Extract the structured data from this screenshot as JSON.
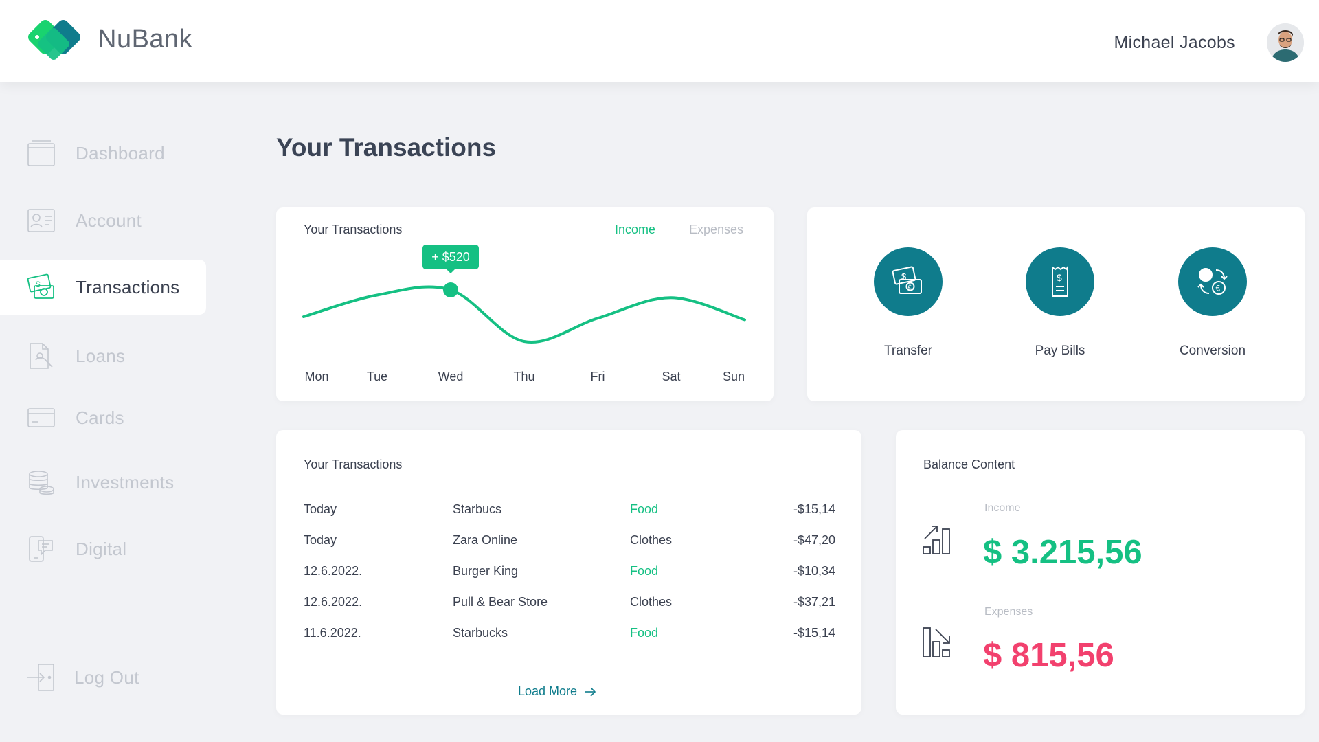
{
  "header": {
    "brand": "NuBank",
    "user_name": "Michael Jacobs"
  },
  "sidebar": {
    "items": [
      {
        "label": "Dashboard",
        "icon": "dashboard-icon",
        "active": false
      },
      {
        "label": "Account",
        "icon": "account-card-icon",
        "active": false
      },
      {
        "label": "Transactions",
        "icon": "money-bills-icon",
        "active": true
      },
      {
        "label": "Loans",
        "icon": "loan-document-icon",
        "active": false
      },
      {
        "label": "Cards",
        "icon": "credit-card-icon",
        "active": false
      },
      {
        "label": "Investments",
        "icon": "coins-stack-icon",
        "active": false
      },
      {
        "label": "Digital",
        "icon": "phone-chat-icon",
        "active": false
      }
    ],
    "logout_label": "Log Out"
  },
  "page": {
    "title": "Your Transactions"
  },
  "chart_card": {
    "title": "Your Transactions",
    "tab_income": "Income",
    "tab_expenses": "Expenses",
    "active_tab": "Income",
    "tooltip": "+ $520",
    "accent": "#15c083"
  },
  "chart_data": {
    "type": "line",
    "categories": [
      "Mon",
      "Tue",
      "Wed",
      "Thu",
      "Fri",
      "Sat",
      "Sun"
    ],
    "highlight": {
      "category": "Wed",
      "label": "+ $520"
    },
    "relative_values": [
      0.48,
      0.9,
      1.0,
      0.0,
      0.45,
      0.85,
      0.42
    ]
  },
  "actions": [
    {
      "label": "Transfer",
      "icon": "money-transfer-icon"
    },
    {
      "label": "Pay Bills",
      "icon": "bill-receipt-icon"
    },
    {
      "label": "Conversion",
      "icon": "currency-conversion-icon"
    }
  ],
  "transactions_card": {
    "title": "Your Transactions",
    "rows": [
      {
        "date": "Today",
        "name": "Starbucs",
        "category": "Food",
        "amount": "-$15,14"
      },
      {
        "date": "Today",
        "name": "Zara Online",
        "category": "Clothes",
        "amount": "-$47,20"
      },
      {
        "date": "12.6.2022.",
        "name": "Burger King",
        "category": "Food",
        "amount": "-$10,34"
      },
      {
        "date": "12.6.2022.",
        "name": "Pull & Bear Store",
        "category": "Clothes",
        "amount": "-$37,21"
      },
      {
        "date": "11.6.2022.",
        "name": "Starbucks",
        "category": "Food",
        "amount": "-$15,14"
      }
    ],
    "load_more": "Load More"
  },
  "balance_card": {
    "title": "Balance Content",
    "income_label": "Income",
    "income_value": "$ 3.215,56",
    "expenses_label": "Expenses",
    "expenses_value": "$ 815,56",
    "income_color": "#15c083",
    "expense_color": "#f2416e"
  }
}
